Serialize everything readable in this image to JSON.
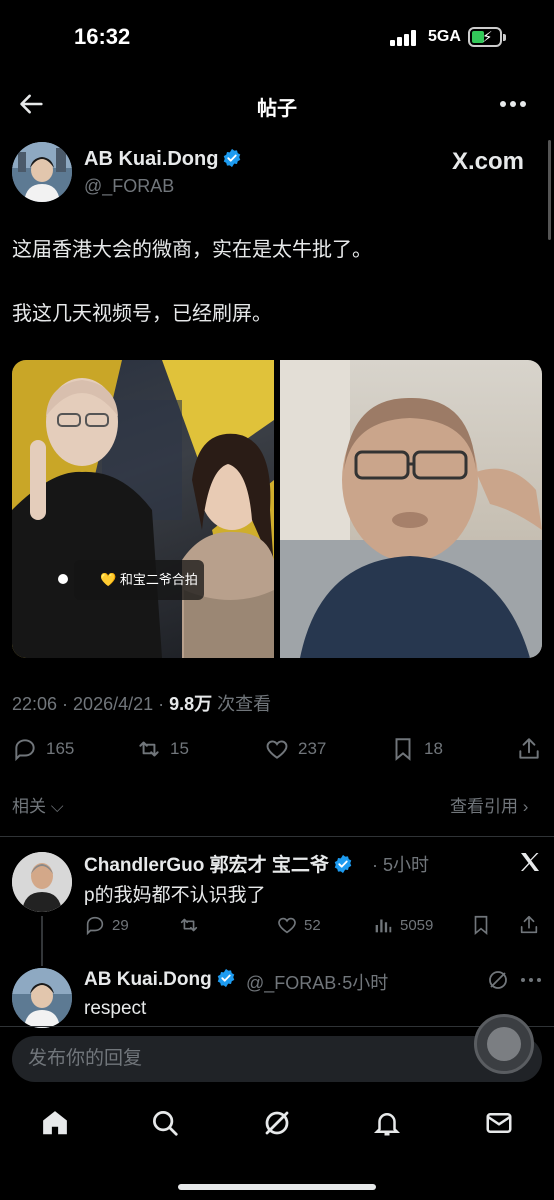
{
  "status_bar": {
    "time": "16:32",
    "network": "5GA",
    "battery_color": "#33c759"
  },
  "nav": {
    "title": "帖子",
    "back_icon": "arrow-left-icon",
    "more_icon": "ellipsis-icon"
  },
  "tweet": {
    "author": "AB Kuai.Dong",
    "handle": "@_FORAB",
    "source_logo": "X.com",
    "lines": [
      "这届香港大会的微商，实在是太牛批了。",
      "我这几天视频号，已经刷屏。"
    ],
    "media_tag": "和宝二爷合拍",
    "meta": {
      "time": "22:06",
      "date": "2026/4/21",
      "views": "9.8万",
      "views_label": "次查看"
    },
    "actions": {
      "replies": "165",
      "reposts": "15",
      "likes": "237",
      "bookmarks": "18"
    },
    "related_label": "相关",
    "quotes_label": "查看引用"
  },
  "replies": [
    {
      "name": "ChandlerGuo 郭宏才 宝二爷",
      "time": "5小时",
      "text": "p的我妈都不认识我了",
      "stats": {
        "replies": "29",
        "likes": "52",
        "views": "5059"
      }
    },
    {
      "name": "AB Kuai.Dong",
      "handle": "@_FORAB",
      "time": "5小时",
      "text": "respect"
    }
  ],
  "composer": {
    "placeholder": "发布你的回复"
  },
  "bottom_nav": [
    "home-icon",
    "search-icon",
    "grok-icon",
    "bell-icon",
    "mail-icon"
  ],
  "colors": {
    "verified": "#1d9bf0",
    "muted": "#71767b",
    "text": "#e7e9ea",
    "background": "#000000"
  }
}
